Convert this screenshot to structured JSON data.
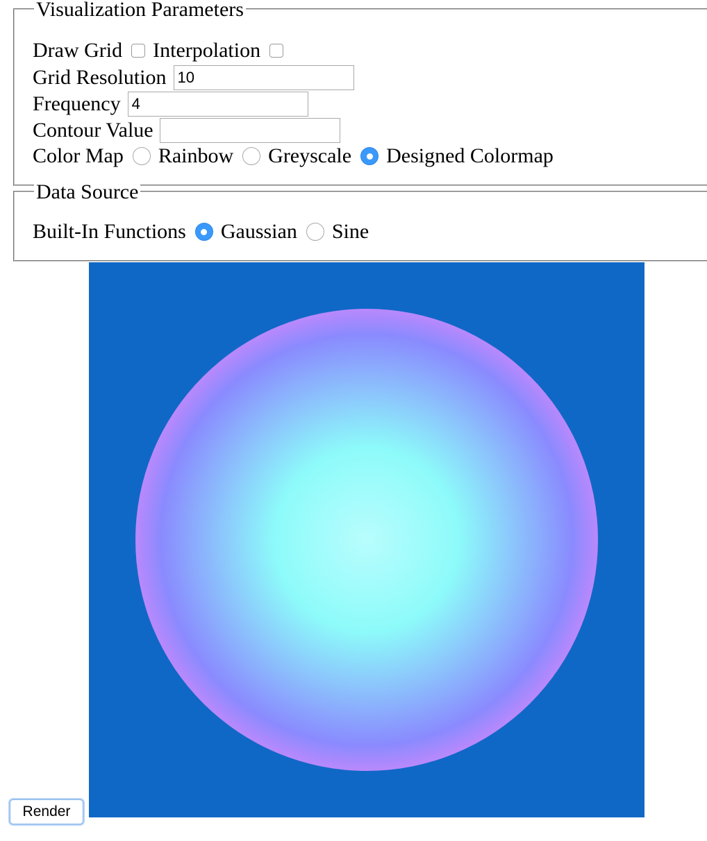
{
  "viz_params": {
    "legend": "Visualization Parameters",
    "draw_grid_label": "Draw Grid",
    "draw_grid_checked": false,
    "interpolation_label": "Interpolation",
    "interpolation_checked": false,
    "grid_resolution_label": "Grid Resolution",
    "grid_resolution_value": "10",
    "frequency_label": "Frequency",
    "frequency_value": "4",
    "contour_value_label": "Contour Value",
    "contour_value_value": "",
    "color_map_label": "Color Map",
    "color_map_options": [
      "Rainbow",
      "Greyscale",
      "Designed Colormap"
    ],
    "color_map_selected": "Designed Colormap"
  },
  "data_source": {
    "legend": "Data Source",
    "builtin_label": "Built-In Functions",
    "function_options": [
      "Gaussian",
      "Sine"
    ],
    "function_selected": "Gaussian"
  },
  "render_button": "Render",
  "visualization": {
    "background_color": "#1068c6",
    "colormap_stops": [
      "#b8fdfd",
      "#8dfbfa",
      "#8a8afe",
      "#fe87fa"
    ]
  }
}
